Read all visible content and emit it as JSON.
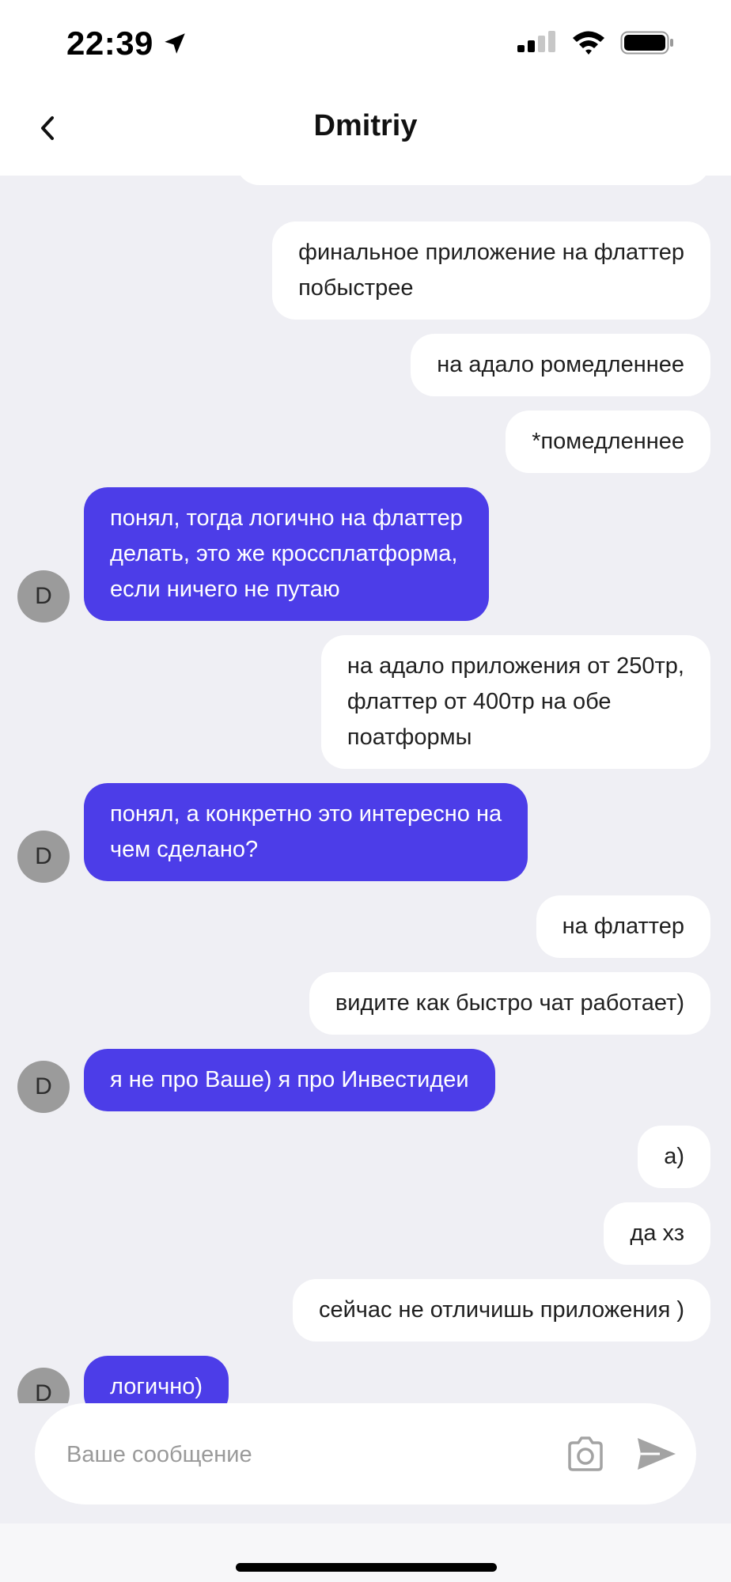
{
  "status_bar": {
    "time": "22:39"
  },
  "header": {
    "title": "Dmitriy"
  },
  "contact": {
    "avatar_letter": "D"
  },
  "messages": [
    {
      "from": "me",
      "lines": [
        "финальное приложение на флаттер",
        "побыстрее"
      ]
    },
    {
      "from": "me",
      "lines": [
        "на адало ромедленнее"
      ]
    },
    {
      "from": "me",
      "lines": [
        "*помедленнее"
      ]
    },
    {
      "from": "contact",
      "lines": [
        "понял, тогда логично на флаттер",
        "делать, это же кроссплатформа,",
        "если ничего не путаю"
      ]
    },
    {
      "from": "me",
      "lines": [
        "на адало приложения от 250тр,",
        "флаттер от 400тр на обе",
        "поатформы"
      ]
    },
    {
      "from": "contact",
      "lines": [
        "понял, а конкретно это интересно на",
        "чем сделано?"
      ]
    },
    {
      "from": "me",
      "lines": [
        "на флаттер"
      ]
    },
    {
      "from": "me",
      "lines": [
        "видите как быстро чат работает)"
      ]
    },
    {
      "from": "contact",
      "lines": [
        "я не про Ваше) я про  Инвестидеи"
      ]
    },
    {
      "from": "me",
      "lines": [
        "а)"
      ]
    },
    {
      "from": "me",
      "lines": [
        "да хз"
      ]
    },
    {
      "from": "me",
      "lines": [
        "сейчас не отличишь приложения )"
      ]
    },
    {
      "from": "contact",
      "lines": [
        "логично)"
      ]
    }
  ],
  "composer": {
    "placeholder": "Ваше сообщение"
  },
  "colors": {
    "incoming_bubble": "#4c3de8",
    "outgoing_bubble": "#ffffff",
    "chat_background": "#efeff4",
    "avatar": "#9b9b9b"
  },
  "icons": {
    "back": "chevron-left-icon",
    "location": "location-arrow-icon",
    "signal": "cellular-signal-icon",
    "wifi": "wifi-icon",
    "battery": "battery-icon",
    "camera": "camera-icon",
    "send": "send-icon"
  }
}
